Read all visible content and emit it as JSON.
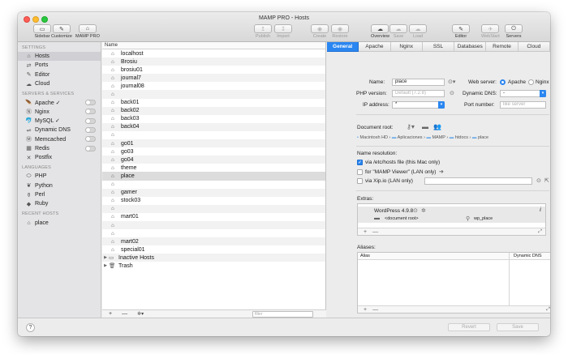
{
  "window": {
    "title": "MAMP PRO - Hosts"
  },
  "toolbar": [
    {
      "name": "sidebar",
      "label": "Sidebar",
      "icon": "▭",
      "enabled": true
    },
    {
      "name": "customize",
      "label": "Customize",
      "icon": "✎",
      "enabled": true
    },
    {
      "name": "mamp-pro",
      "label": "MAMP PRO",
      "icon": "⌂",
      "enabled": true
    },
    {
      "name": "publish",
      "label": "Publish",
      "icon": "↥",
      "enabled": false
    },
    {
      "name": "import",
      "label": "Import",
      "icon": "↧",
      "enabled": false
    },
    {
      "name": "create",
      "label": "Create",
      "icon": "◉",
      "enabled": false
    },
    {
      "name": "restore",
      "label": "Restore",
      "icon": "◉",
      "enabled": false
    },
    {
      "name": "overview",
      "label": "Overview",
      "icon": "☁",
      "enabled": true
    },
    {
      "name": "save",
      "label": "Save",
      "icon": "☁",
      "enabled": false
    },
    {
      "name": "load",
      "label": "Load",
      "icon": "☁",
      "enabled": false
    },
    {
      "name": "editor",
      "label": "Editor",
      "icon": "✎",
      "enabled": true
    },
    {
      "name": "webstart",
      "label": "WebStart",
      "icon": "✈",
      "enabled": false
    },
    {
      "name": "servers",
      "label": "Servers",
      "icon": "⏻",
      "enabled": true
    }
  ],
  "sidebar": {
    "settings_header": "SETTINGS",
    "settings": [
      {
        "label": "Hosts",
        "icon": "⌂",
        "selected": true
      },
      {
        "label": "Ports",
        "icon": "⇄",
        "selected": false
      },
      {
        "label": "Editor",
        "icon": "✎",
        "selected": false
      },
      {
        "label": "Cloud",
        "icon": "☁",
        "selected": false
      }
    ],
    "servers_header": "SERVERS & SERVICES",
    "servers": [
      {
        "label": "Apache ✓",
        "icon": "🪶",
        "toggle": true
      },
      {
        "label": "Nginx",
        "icon": "Ⓝ",
        "toggle": true
      },
      {
        "label": "MySQL ✓",
        "icon": "🐬",
        "toggle": true
      },
      {
        "label": "Dynamic DNS",
        "icon": "⇌",
        "toggle": true
      },
      {
        "label": "Memcached",
        "icon": "Ⓜ",
        "toggle": true
      },
      {
        "label": "Redis",
        "icon": "▦",
        "toggle": true
      },
      {
        "label": "Postfix",
        "icon": "✕",
        "toggle": false
      }
    ],
    "languages_header": "LANGUAGES",
    "languages": [
      {
        "label": "PHP",
        "icon": "⬭"
      },
      {
        "label": "Python",
        "icon": "❦"
      },
      {
        "label": "Perl",
        "icon": "⚱"
      },
      {
        "label": "Ruby",
        "icon": "◆"
      }
    ],
    "recent_header": "RECENT HOSTS",
    "recent": [
      {
        "label": "place",
        "icon": "⌂"
      }
    ]
  },
  "hostlist": {
    "column_header": "Name",
    "rows": [
      {
        "name": "localhost",
        "icon": "⌂",
        "expand": false
      },
      {
        "name": "Brosiu",
        "icon": "⌂",
        "expand": false
      },
      {
        "name": "brosiu01",
        "icon": "⌂",
        "expand": false
      },
      {
        "name": "journal7",
        "icon": "⌂",
        "expand": false
      },
      {
        "name": "journal08",
        "icon": "⌂",
        "expand": false
      },
      {
        "name": "",
        "icon": "⌂",
        "expand": false
      },
      {
        "name": "back01",
        "icon": "⌂",
        "expand": false
      },
      {
        "name": "back02",
        "icon": "⌂",
        "expand": false
      },
      {
        "name": "back03",
        "icon": "⌂",
        "expand": false
      },
      {
        "name": "back04",
        "icon": "⌂",
        "expand": false
      },
      {
        "name": "",
        "icon": "⌂",
        "expand": false
      },
      {
        "name": "go01",
        "icon": "⌂",
        "expand": false
      },
      {
        "name": "go03",
        "icon": "⌂",
        "expand": false
      },
      {
        "name": "go04",
        "icon": "⌂",
        "expand": false
      },
      {
        "name": "theme",
        "icon": "⌂",
        "expand": false
      },
      {
        "name": "place",
        "icon": "⌂",
        "expand": false,
        "selected": true
      },
      {
        "name": "",
        "icon": "⌂",
        "expand": false
      },
      {
        "name": "gamer",
        "icon": "⌂",
        "expand": false
      },
      {
        "name": "stock03",
        "icon": "⌂",
        "expand": false
      },
      {
        "name": "",
        "icon": "⌂",
        "expand": false
      },
      {
        "name": "mart01",
        "icon": "⌂",
        "expand": false
      },
      {
        "name": "",
        "icon": "⌂",
        "expand": false
      },
      {
        "name": "",
        "icon": "⌂",
        "expand": false
      },
      {
        "name": "mart02",
        "icon": "⌂",
        "expand": false
      },
      {
        "name": "special01",
        "icon": "⌂",
        "expand": false
      },
      {
        "name": "Inactive Hosts",
        "icon": "▭",
        "expand": true
      },
      {
        "name": "Trash",
        "icon": "🗑",
        "expand": true
      }
    ],
    "footer": {
      "add": "+",
      "remove": "—",
      "gear": "✲▾",
      "search_prefix": "Q▾",
      "search_placeholder": "filter"
    }
  },
  "panel": {
    "tabs": [
      {
        "label": "General",
        "active": true
      },
      {
        "label": "Apache",
        "active": false
      },
      {
        "label": "Nginx",
        "active": false
      },
      {
        "label": "SSL",
        "active": false
      },
      {
        "label": "Databases",
        "active": false
      },
      {
        "label": "Remote",
        "active": false
      },
      {
        "label": "Cloud",
        "active": false
      }
    ],
    "name_label": "Name:",
    "name_value": "place",
    "php_label": "PHP version:",
    "php_value": "Default (7.2.8)",
    "ip_label": "IP address:",
    "ip_value": "*",
    "webserver_label": "Web server:",
    "webserver_apache": "Apache",
    "webserver_nginx": "Nginx",
    "dyndns_label": "Dynamic DNS:",
    "dyndns_value": "-",
    "port_label": "Port number:",
    "port_placeholder": "like server",
    "docroot_label": "Document root:",
    "docroot_path": [
      "Macintosh HD",
      "Aplicaciones",
      "MAMP",
      "htdocs",
      "place"
    ],
    "nameres_label": "Name resolution:",
    "opt_hosts": "via /etc/hosts file (this Mac only)",
    "opt_viewer": "for \"MAMP Viewer\" (LAN only)",
    "opt_xip": "via Xip.io (LAN only)",
    "extras_label": "Extras:",
    "extra_name": "WordPress 4.9.8",
    "extra_root": "<document root>",
    "extra_target": "wp_place",
    "aliases_label": "Aliases:",
    "alias_col": "Alias",
    "dyndns_col": "Dynamic DNS"
  },
  "bottom": {
    "help": "?",
    "revert": "Revert",
    "save": "Save"
  }
}
